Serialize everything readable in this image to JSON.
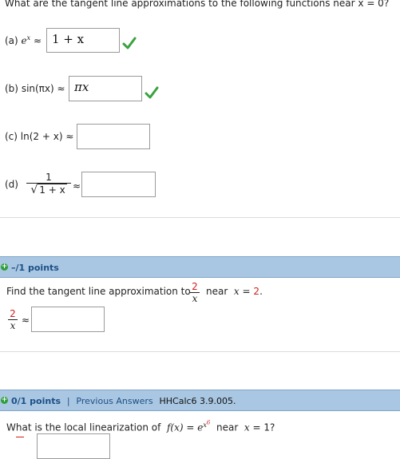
{
  "q1": {
    "prompt": "What are the tangent line approximations to the following functions near x = 0?",
    "a": {
      "label": "(a)",
      "func": "e",
      "sup": "x",
      "approx": "≈",
      "answer": "1 + x"
    },
    "b": {
      "label": "(b)",
      "func": "sin(πx)",
      "approx": "≈",
      "answer": "πx"
    },
    "c": {
      "label": "(c)",
      "func": "ln(2 + x)",
      "approx": "≈",
      "answer": ""
    },
    "d": {
      "label": "(d)",
      "num": "1",
      "den": "1 + x",
      "approx": "≈",
      "answer": ""
    }
  },
  "q2": {
    "points": "–/1 points",
    "prompt": "Find the tangent line approximation to",
    "frac_num": "2",
    "frac_den": "x",
    "near_text": "near",
    "var": "x",
    "equals": "=",
    "value": "2",
    "period": ".",
    "answer_num": "2",
    "answer_den": "x",
    "approx": "≈",
    "answer": ""
  },
  "q3": {
    "points": "0/1 points",
    "separator": "|",
    "previous_answers": "Previous Answers",
    "code": "HHCalc6 3.9.005.",
    "prompt": "What is the local linearization of",
    "func": "f(x)",
    "equals": "=",
    "base": "e",
    "exp_base": "x",
    "exp_power": "6",
    "near_text": "near",
    "var": "x",
    "value": "1?"
  },
  "colors": {
    "band": "#a9c7e2",
    "band_text": "#1d4f86",
    "check": "#3aa23e",
    "red_value": "#d0201e"
  }
}
